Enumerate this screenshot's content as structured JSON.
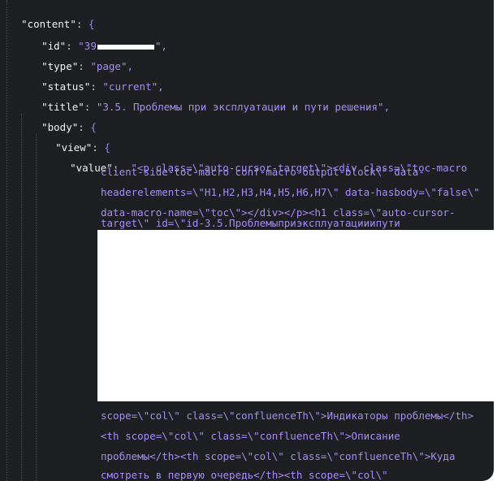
{
  "json_view": {
    "content_key": "\"content\"",
    "id_key": "\"id\"",
    "id_prefix": "\"39",
    "id_suffix": "\",",
    "type_key": "\"type\"",
    "type_value": "\"page\",",
    "status_key": "\"status\"",
    "status_value": "\"current\",",
    "title_key": "\"title\"",
    "title_value": "\"3.5. Проблемы при эксплуатации и пути решения\",",
    "body_key": "\"body\"",
    "view_key": "\"view\"",
    "value_key": "\"value\"",
    "value_lines": [
      "\"<p class=\\\"auto-cursor-target\\\"><div class=\\\"toc-macro",
      "client-side-toc-macro conf-macro output-block\\\" data-",
      "headerelements=\\\"H1,H2,H3,H4,H5,H6,H7\\\" data-hasbody=\\\"false\\\"",
      "data-macro-name=\\\"toc\\\"></div></p><h1 class=\\\"auto-cursor-",
      "target\\\" id=\\\"id-3.5.Проблемыприэксплуатацииипути"
    ],
    "tail_lines": [
      "scope=\\\"col\\\" class=\\\"confluenceTh\\\">Индикаторы проблемы</th>",
      "<th scope=\\\"col\\\" class=\\\"confluenceTh\\\">Описание",
      "проблемы</th><th scope=\\\"col\\\" class=\\\"confluenceTh\\\">Куда",
      "смотреть в первую очередь</th><th scope=\\\"col\\\""
    ]
  }
}
